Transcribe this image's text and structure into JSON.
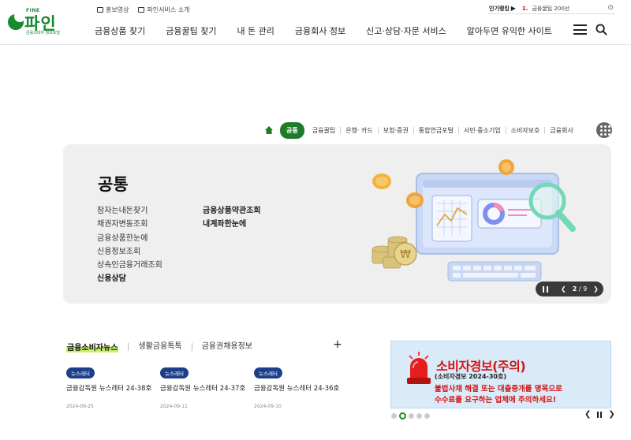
{
  "brand": {
    "fine_label": "FINE",
    "name": "파인",
    "sub": "금융소비자 정보포털"
  },
  "top_links": [
    {
      "label": "홍보영상",
      "icon": "play-icon"
    },
    {
      "label": "파인서비스 소개",
      "icon": "document-icon"
    }
  ],
  "nav": [
    "금융상품 찾기",
    "금융꿀팁 찾기",
    "내 돈 관리",
    "금융회사 정보",
    "신고·상담·자문 서비스",
    "알아두면 유익한 사이트"
  ],
  "ranking": {
    "title": "인기랭킹",
    "rank": "1.",
    "item": "금융꿀팁 200선"
  },
  "breadcrumb": {
    "active": "공통",
    "items": [
      "금융꿀팁",
      "은행· 카드",
      "보험·증권",
      "통합연금포털",
      "서민·중소기업",
      "소비자보호",
      "금융회사"
    ]
  },
  "hero": {
    "title": "공통",
    "col1": [
      "잠자는내돈찾기",
      "채권자변동조회",
      "금융상품한눈에",
      "신용정보조회",
      "상속인금융거래조회",
      "신용상담"
    ],
    "col2": [
      "금융상품약관조회",
      "내계좌한눈에"
    ],
    "pager": {
      "current": "2",
      "total": "9",
      "separator": "/"
    }
  },
  "news": {
    "tabs": [
      "금융소비자뉴스",
      "생활금융톡톡",
      "금융권채용정보"
    ],
    "plus": "+",
    "cards": [
      {
        "badge": "뉴스레터",
        "title": "금융감독원 뉴스레터 24-38호",
        "date": "2024-09-25"
      },
      {
        "badge": "뉴스레터",
        "title": "금융감독원 뉴스레터 24-37호",
        "date": "2024-09-11"
      },
      {
        "badge": "뉴스레터",
        "title": "금융감독원 뉴스레터 24-36호",
        "date": "2024-09-10"
      }
    ]
  },
  "banner": {
    "title": "소비자경보(주의)",
    "sub": "(소비자경보 2024-30호)",
    "line1": "불법사채 해결 또는 대출중개를 명목으로",
    "line2": "수수료를 요구하는 업체에 주의하세요!",
    "dot_count": 5,
    "active_dot": 2
  },
  "colors": {
    "brand_green": "#178a2e",
    "active_pill": "#1f7a2a",
    "badge_blue": "#1c3f8a",
    "alert_red": "#d41414",
    "banner_bg": "#d9ebf9",
    "hero_bg": "#efefef"
  }
}
